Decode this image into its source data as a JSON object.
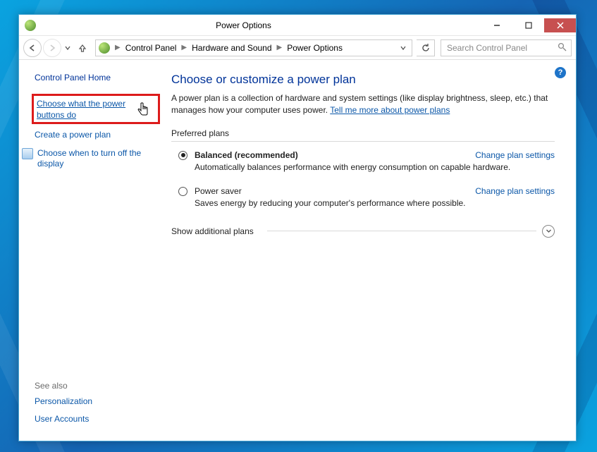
{
  "titlebar": {
    "title": "Power Options"
  },
  "breadcrumb": {
    "items": [
      "Control Panel",
      "Hardware and Sound",
      "Power Options"
    ]
  },
  "search": {
    "placeholder": "Search Control Panel"
  },
  "sidebar": {
    "home": "Control Panel Home",
    "links": {
      "choose_buttons": "Choose what the power buttons do",
      "create_plan": "Create a power plan",
      "turn_off_display": "Choose when to turn off the display"
    },
    "see_also_label": "See also",
    "see_also": [
      "Personalization",
      "User Accounts"
    ]
  },
  "main": {
    "heading": "Choose or customize a power plan",
    "description_pre": "A power plan is a collection of hardware and system settings (like display brightness, sleep, etc.) that manages how your computer uses power. ",
    "description_link": "Tell me more about power plans",
    "preferred_label": "Preferred plans",
    "plans": [
      {
        "name": "Balanced (recommended)",
        "selected": true,
        "desc": "Automatically balances performance with energy consumption on capable hardware.",
        "change": "Change plan settings"
      },
      {
        "name": "Power saver",
        "selected": false,
        "desc": "Saves energy by reducing your computer's performance where possible.",
        "change": "Change plan settings"
      }
    ],
    "show_more": "Show additional plans"
  }
}
